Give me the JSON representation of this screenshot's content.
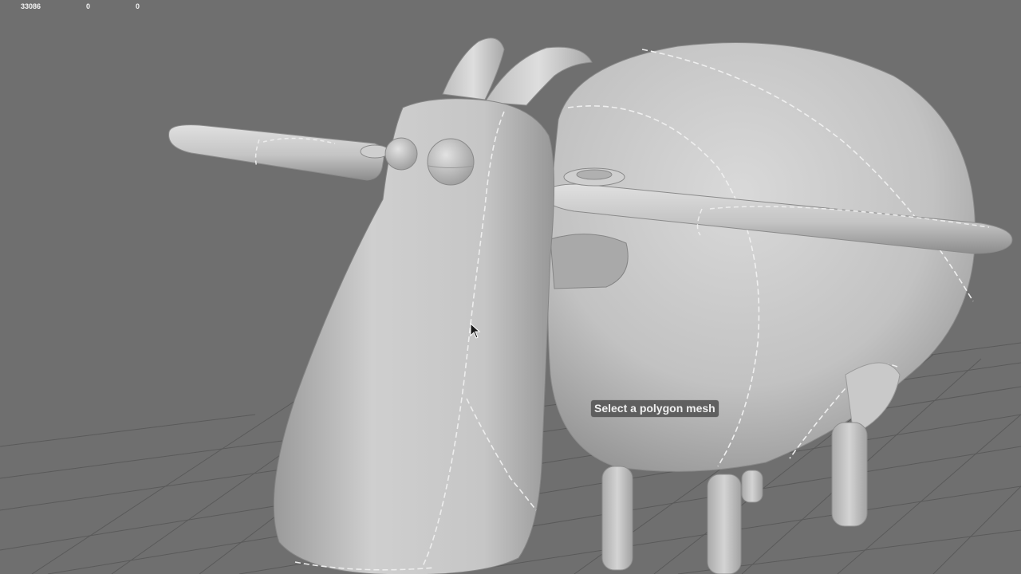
{
  "hud": {
    "stats": [
      "33086",
      "0",
      "0"
    ]
  },
  "viewport": {
    "hint_text": "Select a polygon mesh"
  },
  "colors": {
    "background": "#6f6f6f",
    "grid_line": "#585858",
    "model_light": "#d8d8d8",
    "model_mid": "#b4b4b4",
    "model_dark": "#8a8a8a",
    "stitch": "#f0f0f0",
    "hud_text": "#f2f2f2"
  },
  "icons": {
    "cursor": "arrow-cursor-icon"
  }
}
